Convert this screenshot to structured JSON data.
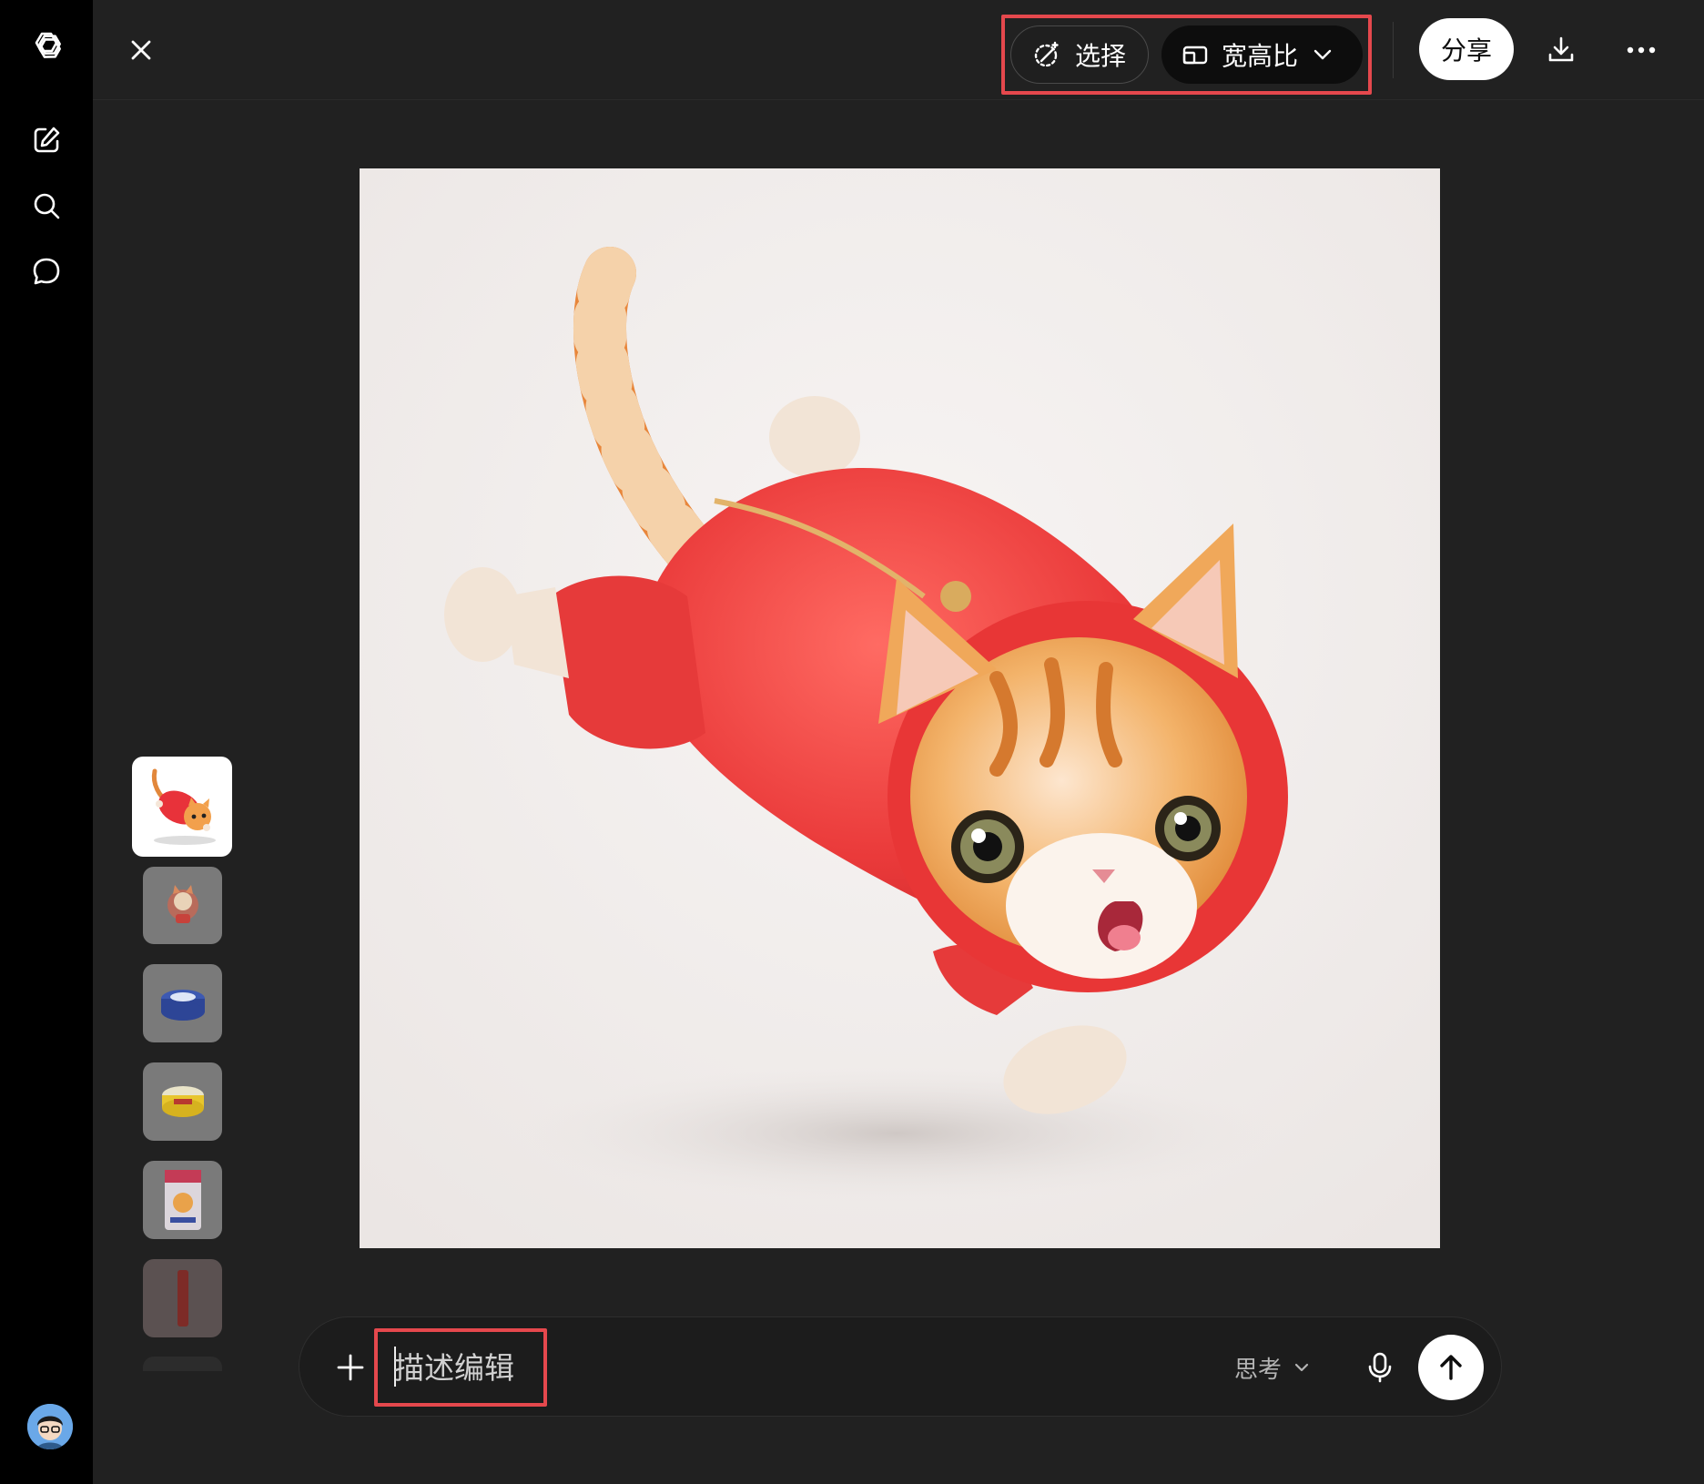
{
  "toolbar": {
    "select_label": "选择",
    "aspect_label": "宽高比",
    "share_label": "分享"
  },
  "composer": {
    "placeholder": "描述编辑",
    "think_label": "思考"
  },
  "colors": {
    "accent_highlight": "#e5484d",
    "background": "#212121",
    "rail": "#000000"
  },
  "icons": [
    "openai-logo-icon",
    "new-chat-icon",
    "search-icon",
    "chat-bubble-icon",
    "close-icon",
    "select-sparkle-icon",
    "aspect-ratio-icon",
    "chevron-down-icon",
    "download-icon",
    "more-icon",
    "plus-icon",
    "microphone-icon",
    "arrow-up-icon"
  ]
}
